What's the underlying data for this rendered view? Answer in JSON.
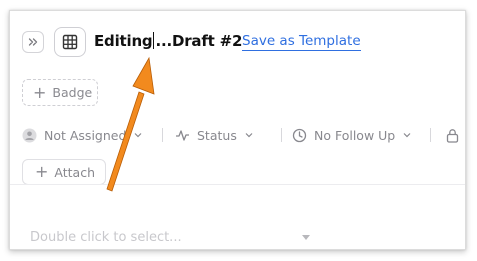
{
  "header": {
    "expand_icon": "chevrons-right-icon",
    "table_icon": "table-icon",
    "title_before_caret": "Editing",
    "title_after_caret": "...Draft #2",
    "save_template_label": "Save as Template"
  },
  "badge": {
    "icon": "plus-icon",
    "label": "Badge"
  },
  "properties": {
    "assignee": {
      "icon": "avatar-icon",
      "label": "Not Assigned"
    },
    "status": {
      "icon": "activity-icon",
      "label": "Status"
    },
    "follow_up": {
      "icon": "clock-icon",
      "label": "No Follow Up"
    },
    "lock": {
      "icon": "lock-icon"
    }
  },
  "attach": {
    "icon": "plus-icon",
    "label": "Attach"
  },
  "select": {
    "placeholder": "Double click to select..."
  },
  "annotation": {
    "arrow_color": "#f28a1e"
  },
  "colors": {
    "link": "#2f6fe0",
    "muted_text": "#88888e"
  }
}
